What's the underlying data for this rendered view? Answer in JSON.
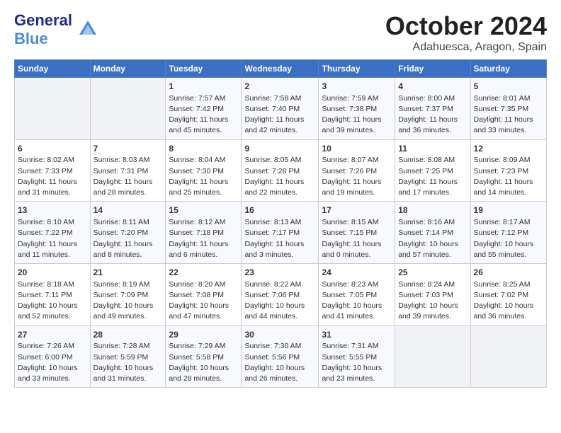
{
  "header": {
    "logo_general": "General",
    "logo_blue": "Blue",
    "month_title": "October 2024",
    "location": "Adahuesca, Aragon, Spain"
  },
  "weekdays": [
    "Sunday",
    "Monday",
    "Tuesday",
    "Wednesday",
    "Thursday",
    "Friday",
    "Saturday"
  ],
  "weeks": [
    [
      {
        "day": "",
        "sunrise": "",
        "sunset": "",
        "daylight": ""
      },
      {
        "day": "",
        "sunrise": "",
        "sunset": "",
        "daylight": ""
      },
      {
        "day": "1",
        "sunrise": "Sunrise: 7:57 AM",
        "sunset": "Sunset: 7:42 PM",
        "daylight": "Daylight: 11 hours and 45 minutes."
      },
      {
        "day": "2",
        "sunrise": "Sunrise: 7:58 AM",
        "sunset": "Sunset: 7:40 PM",
        "daylight": "Daylight: 11 hours and 42 minutes."
      },
      {
        "day": "3",
        "sunrise": "Sunrise: 7:59 AM",
        "sunset": "Sunset: 7:38 PM",
        "daylight": "Daylight: 11 hours and 39 minutes."
      },
      {
        "day": "4",
        "sunrise": "Sunrise: 8:00 AM",
        "sunset": "Sunset: 7:37 PM",
        "daylight": "Daylight: 11 hours and 36 minutes."
      },
      {
        "day": "5",
        "sunrise": "Sunrise: 8:01 AM",
        "sunset": "Sunset: 7:35 PM",
        "daylight": "Daylight: 11 hours and 33 minutes."
      }
    ],
    [
      {
        "day": "6",
        "sunrise": "Sunrise: 8:02 AM",
        "sunset": "Sunset: 7:33 PM",
        "daylight": "Daylight: 11 hours and 31 minutes."
      },
      {
        "day": "7",
        "sunrise": "Sunrise: 8:03 AM",
        "sunset": "Sunset: 7:31 PM",
        "daylight": "Daylight: 11 hours and 28 minutes."
      },
      {
        "day": "8",
        "sunrise": "Sunrise: 8:04 AM",
        "sunset": "Sunset: 7:30 PM",
        "daylight": "Daylight: 11 hours and 25 minutes."
      },
      {
        "day": "9",
        "sunrise": "Sunrise: 8:05 AM",
        "sunset": "Sunset: 7:28 PM",
        "daylight": "Daylight: 11 hours and 22 minutes."
      },
      {
        "day": "10",
        "sunrise": "Sunrise: 8:07 AM",
        "sunset": "Sunset: 7:26 PM",
        "daylight": "Daylight: 11 hours and 19 minutes."
      },
      {
        "day": "11",
        "sunrise": "Sunrise: 8:08 AM",
        "sunset": "Sunset: 7:25 PM",
        "daylight": "Daylight: 11 hours and 17 minutes."
      },
      {
        "day": "12",
        "sunrise": "Sunrise: 8:09 AM",
        "sunset": "Sunset: 7:23 PM",
        "daylight": "Daylight: 11 hours and 14 minutes."
      }
    ],
    [
      {
        "day": "13",
        "sunrise": "Sunrise: 8:10 AM",
        "sunset": "Sunset: 7:22 PM",
        "daylight": "Daylight: 11 hours and 11 minutes."
      },
      {
        "day": "14",
        "sunrise": "Sunrise: 8:11 AM",
        "sunset": "Sunset: 7:20 PM",
        "daylight": "Daylight: 11 hours and 8 minutes."
      },
      {
        "day": "15",
        "sunrise": "Sunrise: 8:12 AM",
        "sunset": "Sunset: 7:18 PM",
        "daylight": "Daylight: 11 hours and 6 minutes."
      },
      {
        "day": "16",
        "sunrise": "Sunrise: 8:13 AM",
        "sunset": "Sunset: 7:17 PM",
        "daylight": "Daylight: 11 hours and 3 minutes."
      },
      {
        "day": "17",
        "sunrise": "Sunrise: 8:15 AM",
        "sunset": "Sunset: 7:15 PM",
        "daylight": "Daylight: 11 hours and 0 minutes."
      },
      {
        "day": "18",
        "sunrise": "Sunrise: 8:16 AM",
        "sunset": "Sunset: 7:14 PM",
        "daylight": "Daylight: 10 hours and 57 minutes."
      },
      {
        "day": "19",
        "sunrise": "Sunrise: 8:17 AM",
        "sunset": "Sunset: 7:12 PM",
        "daylight": "Daylight: 10 hours and 55 minutes."
      }
    ],
    [
      {
        "day": "20",
        "sunrise": "Sunrise: 8:18 AM",
        "sunset": "Sunset: 7:11 PM",
        "daylight": "Daylight: 10 hours and 52 minutes."
      },
      {
        "day": "21",
        "sunrise": "Sunrise: 8:19 AM",
        "sunset": "Sunset: 7:09 PM",
        "daylight": "Daylight: 10 hours and 49 minutes."
      },
      {
        "day": "22",
        "sunrise": "Sunrise: 8:20 AM",
        "sunset": "Sunset: 7:08 PM",
        "daylight": "Daylight: 10 hours and 47 minutes."
      },
      {
        "day": "23",
        "sunrise": "Sunrise: 8:22 AM",
        "sunset": "Sunset: 7:06 PM",
        "daylight": "Daylight: 10 hours and 44 minutes."
      },
      {
        "day": "24",
        "sunrise": "Sunrise: 8:23 AM",
        "sunset": "Sunset: 7:05 PM",
        "daylight": "Daylight: 10 hours and 41 minutes."
      },
      {
        "day": "25",
        "sunrise": "Sunrise: 8:24 AM",
        "sunset": "Sunset: 7:03 PM",
        "daylight": "Daylight: 10 hours and 39 minutes."
      },
      {
        "day": "26",
        "sunrise": "Sunrise: 8:25 AM",
        "sunset": "Sunset: 7:02 PM",
        "daylight": "Daylight: 10 hours and 36 minutes."
      }
    ],
    [
      {
        "day": "27",
        "sunrise": "Sunrise: 7:26 AM",
        "sunset": "Sunset: 6:00 PM",
        "daylight": "Daylight: 10 hours and 33 minutes."
      },
      {
        "day": "28",
        "sunrise": "Sunrise: 7:28 AM",
        "sunset": "Sunset: 5:59 PM",
        "daylight": "Daylight: 10 hours and 31 minutes."
      },
      {
        "day": "29",
        "sunrise": "Sunrise: 7:29 AM",
        "sunset": "Sunset: 5:58 PM",
        "daylight": "Daylight: 10 hours and 28 minutes."
      },
      {
        "day": "30",
        "sunrise": "Sunrise: 7:30 AM",
        "sunset": "Sunset: 5:56 PM",
        "daylight": "Daylight: 10 hours and 26 minutes."
      },
      {
        "day": "31",
        "sunrise": "Sunrise: 7:31 AM",
        "sunset": "Sunset: 5:55 PM",
        "daylight": "Daylight: 10 hours and 23 minutes."
      },
      {
        "day": "",
        "sunrise": "",
        "sunset": "",
        "daylight": ""
      },
      {
        "day": "",
        "sunrise": "",
        "sunset": "",
        "daylight": ""
      }
    ]
  ]
}
